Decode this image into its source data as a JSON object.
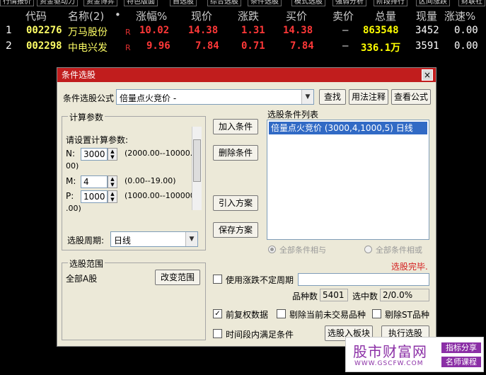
{
  "top_tabs": [
    "行情报价",
    "资金驱动力",
    "资金博弈",
    "特色版面",
    "自选股",
    "综合选股",
    "条件选股",
    "模式选股",
    "强弱分析",
    "阶段排行",
    "区间涨跌",
    "财联社"
  ],
  "quote_header": {
    "code": "代码",
    "name": "名称(2)",
    "dot": "•",
    "change_pct": "涨幅%",
    "price": "现价",
    "change": "涨跌",
    "bid": "买价",
    "ask": "卖价",
    "volume": "总量",
    "cur_vol": "现量",
    "speed": "涨速%"
  },
  "quote_rows": [
    {
      "idx": "1",
      "code": "002276",
      "name": "万马股份",
      "flag": "R",
      "change_pct": "10.02",
      "price": "14.38",
      "change": "1.31",
      "bid": "14.38",
      "ask": "–",
      "volume": "863548",
      "cur_vol": "3452",
      "speed": "0.00"
    },
    {
      "idx": "2",
      "code": "002298",
      "name": "中电兴发",
      "flag": "R",
      "change_pct": "9.96",
      "price": "7.84",
      "change": "0.71",
      "bid": "7.84",
      "ask": "–",
      "volume": "336.1万",
      "cur_vol": "3591",
      "speed": "0.00"
    }
  ],
  "dialog": {
    "title": "条件选股",
    "close": "×",
    "formula_label": "条件选股公式",
    "formula_value": "倍量点火竞价  -",
    "find_btn": "查找",
    "usage_btn": "用法注释",
    "view_btn": "查看公式",
    "calc_group": "计算参数",
    "calc_prompt": "请设置计算参数:",
    "params": [
      {
        "label": "N:",
        "value": "3000",
        "range": "(2000.00--10000.",
        "range2": "00)"
      },
      {
        "label": "M:",
        "value": "4",
        "range": "(0.00--19.00)",
        "range2": ""
      },
      {
        "label": "P:",
        "value": "1000",
        "range": "(1000.00--100000",
        "range2": ".00)"
      }
    ],
    "period_label": "选股周期:",
    "period_value": "日线",
    "add_btn": "加入条件",
    "del_btn": "删除条件",
    "import_btn": "引入方案",
    "save_btn": "保存方案",
    "list_title": "选股条件列表",
    "list_items": [
      "倍量点火竞价 (3000,4,1000,5) 日线"
    ],
    "radio_and": "全部条件相与",
    "radio_or": "全部条件相或",
    "status": "选股完毕.",
    "scope_group": "选股范围",
    "scope_value": "全部A股",
    "scope_btn": "改变范围",
    "use_period_chk": "使用涨跌不定周期",
    "count_label": "品种数",
    "count_value": "5401",
    "selected_label": "选中数",
    "selected_value": "2/0.0%",
    "chk_adjust": "前复权数据",
    "chk_exclude_untraded": "剔除当前未交易品种",
    "chk_exclude_st": "剔除ST品种",
    "chk_time": "时间段内满足条件",
    "to_block_btn": "选股入板块",
    "run_btn": "执行选股"
  },
  "watermark": {
    "title": "股市财富网",
    "url": "WWW.GSCFW.COM",
    "tag1": "指标分享",
    "tag2": "名师课程"
  },
  "colors": {
    "title_bar": "#c11d1d",
    "selection": "#316ac5",
    "up_red": "#ff3838",
    "code_yellow": "#ffff66",
    "watermark": "#8b2fa6"
  }
}
